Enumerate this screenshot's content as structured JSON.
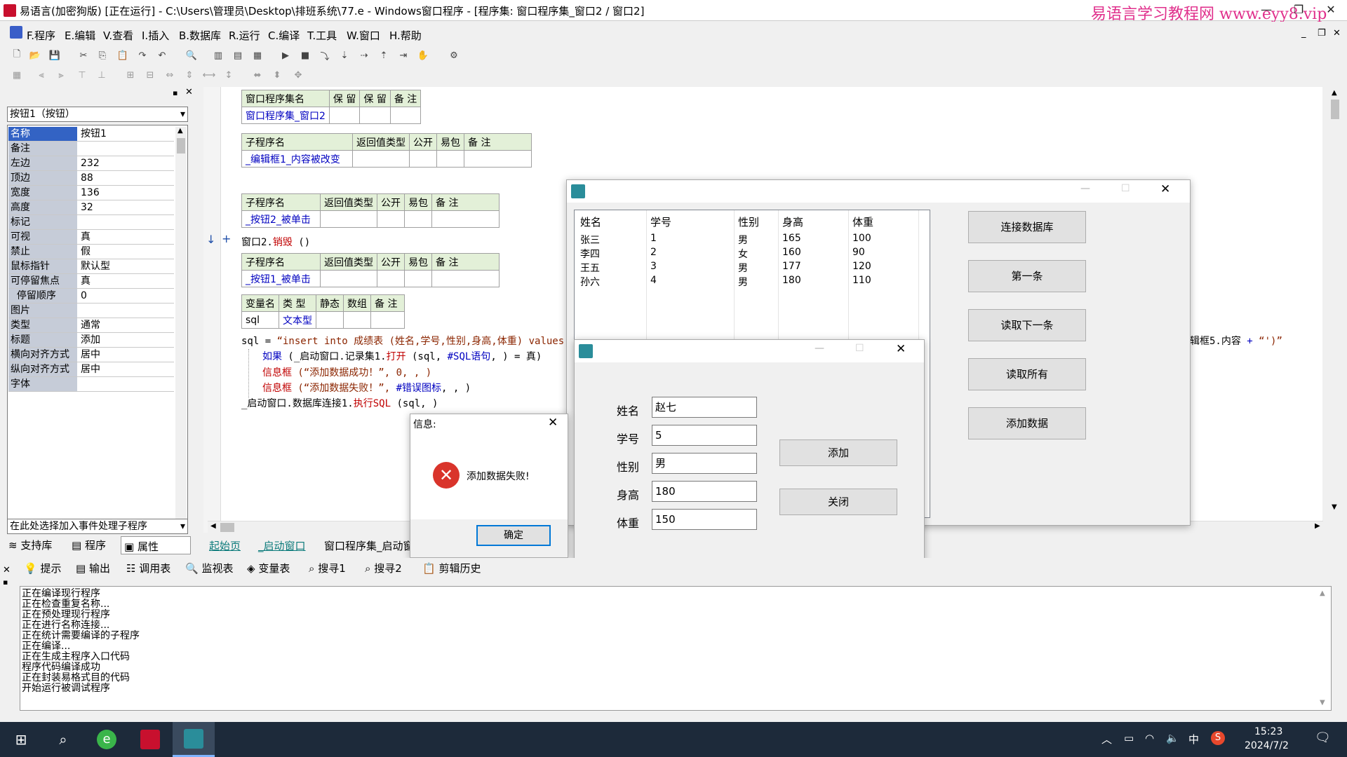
{
  "titlebar": {
    "title": "易语言(加密狗版) [正在运行] - C:\\Users\\管理员\\Desktop\\排班系统\\77.e - Windows窗口程序 - [程序集: 窗口程序集_窗口2 / 窗口2]",
    "watermark": "易语言学习教程网 www.eyy8.vip"
  },
  "menu": [
    "F.程序",
    "E.编辑",
    "V.查看",
    "I.插入",
    "B.数据库",
    "R.运行",
    "C.编译",
    "T.工具",
    "W.窗口",
    "H.帮助"
  ],
  "leftpanel": {
    "component_select": "按钮1（按钮）",
    "properties": [
      {
        "k": "名称",
        "v": "按钮1"
      },
      {
        "k": "备注",
        "v": ""
      },
      {
        "k": "左边",
        "v": "232"
      },
      {
        "k": "顶边",
        "v": "88"
      },
      {
        "k": "宽度",
        "v": "136"
      },
      {
        "k": "高度",
        "v": "32"
      },
      {
        "k": "标记",
        "v": ""
      },
      {
        "k": "可视",
        "v": "真"
      },
      {
        "k": "禁止",
        "v": "假"
      },
      {
        "k": "鼠标指针",
        "v": "默认型"
      },
      {
        "k": "可停留焦点",
        "v": "真"
      },
      {
        "k": "  停留顺序",
        "v": "0"
      },
      {
        "k": "图片",
        "v": ""
      },
      {
        "k": "类型",
        "v": "通常"
      },
      {
        "k": "标题",
        "v": "添加"
      },
      {
        "k": "横向对齐方式",
        "v": "居中"
      },
      {
        "k": "纵向对齐方式",
        "v": "居中"
      },
      {
        "k": "字体",
        "v": ""
      }
    ],
    "event_select": "在此处选择加入事件处理子程序",
    "tabs": [
      "支持库",
      "程序",
      "属性"
    ]
  },
  "code": {
    "t1": {
      "headers": [
        "窗口程序集名",
        "保 留",
        "保 留",
        "备 注"
      ],
      "row": [
        "窗口程序集_窗口2",
        "",
        "",
        ""
      ]
    },
    "t2": {
      "headers": [
        "子程序名",
        "返回值类型",
        "公开",
        "易包",
        "备 注"
      ],
      "row": [
        "_编辑框1_内容被改变",
        "",
        "",
        "",
        ""
      ]
    },
    "t3": {
      "headers": [
        "子程序名",
        "返回值类型",
        "公开",
        "易包",
        "备 注"
      ],
      "row": [
        "_按钮2_被单击",
        "",
        "",
        "",
        ""
      ]
    },
    "line1a": "窗口2.",
    "line1b": "销毁",
    "line1c": " ()",
    "t4": {
      "headers": [
        "子程序名",
        "返回值类型",
        "公开",
        "易包",
        "备 注"
      ],
      "row": [
        "_按钮1_被单击",
        "",
        "",
        "",
        ""
      ]
    },
    "t5": {
      "headers": [
        "变量名",
        "类 型",
        "静态",
        "数组",
        "备 注"
      ],
      "row": [
        "sql",
        "文本型",
        "",
        "",
        ""
      ]
    },
    "l_sql_a": "sql = ",
    "l_sql_b": "“insert into 成绩表 (姓名,学号,性别,身高,体重) values",
    "l_if_a": "如果",
    "l_if_b": " (_启动窗口.记录集1.",
    "l_if_c": "打开",
    "l_if_d": " (sql, ",
    "l_if_e": "#SQL语句",
    "l_if_f": ", ) = 真)",
    "l_msg1_a": "信息框",
    "l_msg1_b": " (“添加数据成功！”, 0, , )",
    "l_msg2_a": "信息框",
    "l_msg2_b": " (“添加数据失败！”, ",
    "l_msg2_c": "#错误图标",
    "l_msg2_d": ", , )",
    "l_exec_a": "_启动窗口.数据库连接1.",
    "l_exec_b": "执行SQL",
    "l_exec_c": " (sql, )",
    "right_frag_a": "辑框5.内容 ",
    "right_frag_b": "+ ",
    "right_frag_c": "“')”"
  },
  "codetabs": [
    "起始页",
    "_启动窗口",
    "窗口程序集_启动窗"
  ],
  "mainwin": {
    "columns": [
      "姓名",
      "学号",
      "性别",
      "身高",
      "体重"
    ],
    "rows": [
      [
        "张三",
        "1",
        "男",
        "165",
        "100"
      ],
      [
        "李四",
        "2",
        "女",
        "160",
        "90"
      ],
      [
        "王五",
        "3",
        "男",
        "177",
        "120"
      ],
      [
        "孙六",
        "4",
        "男",
        "180",
        "110"
      ]
    ],
    "buttons": [
      "连接数据库",
      "第一条",
      "读取下一条",
      "读取所有",
      "添加数据"
    ]
  },
  "addwin": {
    "labels": [
      "姓名",
      "学号",
      "性别",
      "身高",
      "体重"
    ],
    "values": [
      "赵七",
      "5",
      "男",
      "180",
      "150"
    ],
    "add_btn": "添加",
    "close_btn": "关闭"
  },
  "msgbox": {
    "title": "信息:",
    "text": "添加数据失败!",
    "ok": "确定"
  },
  "bottomtabs": [
    "提示",
    "输出",
    "调用表",
    "监视表",
    "变量表",
    "搜寻1",
    "搜寻2",
    "剪辑历史"
  ],
  "output": [
    "正在编译现行程序",
    "正在检查重复名称...",
    "正在预处理现行程序",
    "正在进行名称连接...",
    "正在统计需要编译的子程序",
    "正在编译...",
    "正在生成主程序入口代码",
    "程序代码编译成功",
    "正在封装易格式目的代码",
    "开始运行被调试程序"
  ],
  "taskbar": {
    "time": "15:23",
    "date": "2024/7/2",
    "ime": "中"
  },
  "colors": {
    "accent": "#3363c4",
    "header_green": "#e3f0d8",
    "error_red": "#d9342b",
    "taskbar": "#1d2a3a"
  }
}
